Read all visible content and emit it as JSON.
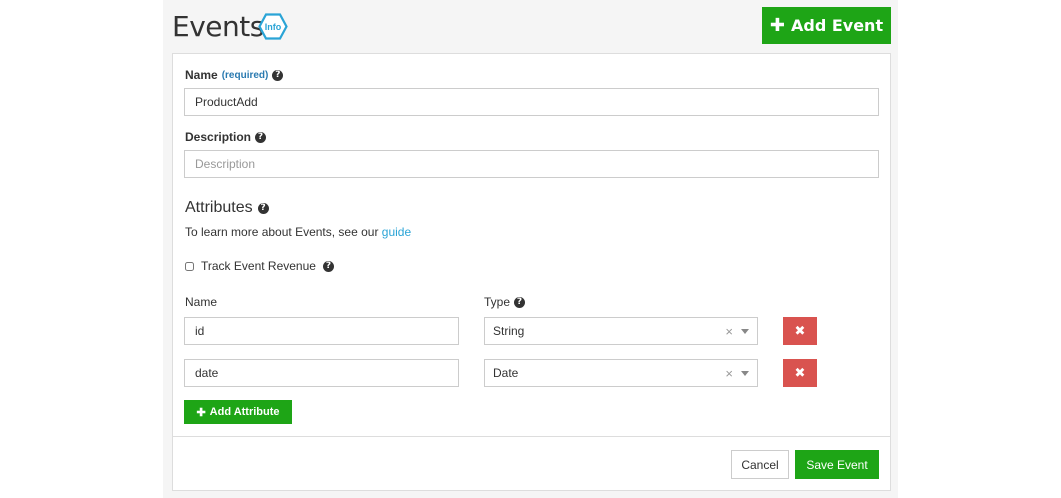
{
  "header": {
    "title": "Events",
    "info_badge_label": "Info",
    "add_event_label": "Add Event"
  },
  "form": {
    "name_label": "Name",
    "name_required": "(required)",
    "name_value": "ProductAdd",
    "description_label": "Description",
    "description_placeholder": "Description",
    "attributes_title": "Attributes",
    "learn_text": "To learn more about Events, see our",
    "learn_link": "guide",
    "track_revenue_label": "Track Event Revenue",
    "col_name": "Name",
    "col_type": "Type",
    "attributes": [
      {
        "name": "id",
        "type": "String"
      },
      {
        "name": "date",
        "type": "Date"
      }
    ],
    "add_attribute_label": "Add Attribute"
  },
  "footer": {
    "cancel_label": "Cancel",
    "save_label": "Save Event"
  },
  "colors": {
    "primary_green": "#1ea516",
    "danger_red": "#d9534f",
    "info_teal": "#2aa4d6"
  }
}
